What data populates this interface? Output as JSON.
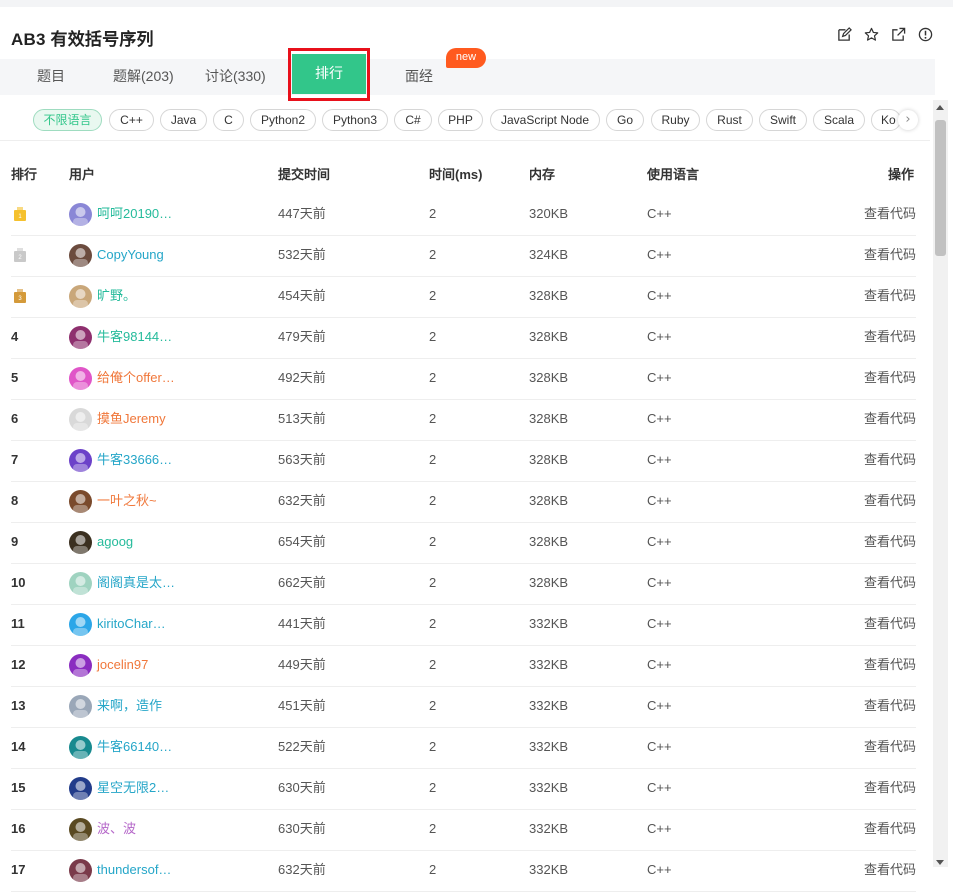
{
  "header": {
    "title": "AB3  有效括号序列"
  },
  "tabs": [
    {
      "label": "题目"
    },
    {
      "label": "题解(203)"
    },
    {
      "label": "讨论(330)"
    },
    {
      "label": "排行"
    },
    {
      "label": "面经"
    }
  ],
  "new_badge": "new",
  "languages": [
    "不限语言",
    "C++",
    "Java",
    "C",
    "Python2",
    "Python3",
    "C#",
    "PHP",
    "JavaScript Node",
    "Go",
    "Ruby",
    "Rust",
    "Swift",
    "Scala",
    "Ko"
  ],
  "columns": {
    "rank": "排行",
    "user": "用户",
    "time": "提交时间",
    "ms": "时间(ms)",
    "mem": "内存",
    "lang": "使用语言",
    "op": "操作"
  },
  "rows": [
    {
      "rank": "1",
      "user": "呵呵20190…",
      "time": "447天前",
      "ms": "2",
      "mem": "320KB",
      "lang": "C++",
      "op": "查看代码",
      "color": "#25bb9b"
    },
    {
      "rank": "2",
      "user": "CopyYoung",
      "time": "532天前",
      "ms": "2",
      "mem": "324KB",
      "lang": "C++",
      "op": "查看代码",
      "color": "#25a6c8"
    },
    {
      "rank": "3",
      "user": "旷野。",
      "time": "454天前",
      "ms": "2",
      "mem": "328KB",
      "lang": "C++",
      "op": "查看代码",
      "color": "#25bb9b"
    },
    {
      "rank": "4",
      "user": "牛客98144…",
      "time": "479天前",
      "ms": "2",
      "mem": "328KB",
      "lang": "C++",
      "op": "查看代码",
      "color": "#25bb9b"
    },
    {
      "rank": "5",
      "user": "给俺个offer…",
      "time": "492天前",
      "ms": "2",
      "mem": "328KB",
      "lang": "C++",
      "op": "查看代码",
      "color": "#f0773a"
    },
    {
      "rank": "6",
      "user": "摸鱼Jeremy",
      "time": "513天前",
      "ms": "2",
      "mem": "328KB",
      "lang": "C++",
      "op": "查看代码",
      "color": "#f0773a"
    },
    {
      "rank": "7",
      "user": "牛客33666…",
      "time": "563天前",
      "ms": "2",
      "mem": "328KB",
      "lang": "C++",
      "op": "查看代码",
      "color": "#25a6c8"
    },
    {
      "rank": "8",
      "user": "一叶之秋~",
      "time": "632天前",
      "ms": "2",
      "mem": "328KB",
      "lang": "C++",
      "op": "查看代码",
      "color": "#f0773a"
    },
    {
      "rank": "9",
      "user": "agoog",
      "time": "654天前",
      "ms": "2",
      "mem": "328KB",
      "lang": "C++",
      "op": "查看代码",
      "color": "#25bb9b"
    },
    {
      "rank": "10",
      "user": "阁阁真是太…",
      "time": "662天前",
      "ms": "2",
      "mem": "328KB",
      "lang": "C++",
      "op": "查看代码",
      "color": "#25a6c8"
    },
    {
      "rank": "11",
      "user": "kiritoChar…",
      "time": "441天前",
      "ms": "2",
      "mem": "332KB",
      "lang": "C++",
      "op": "查看代码",
      "color": "#25a6c8"
    },
    {
      "rank": "12",
      "user": "jocelin97",
      "time": "449天前",
      "ms": "2",
      "mem": "332KB",
      "lang": "C++",
      "op": "查看代码",
      "color": "#f0773a"
    },
    {
      "rank": "13",
      "user": "来啊，造作",
      "time": "451天前",
      "ms": "2",
      "mem": "332KB",
      "lang": "C++",
      "op": "查看代码",
      "color": "#25a6c8"
    },
    {
      "rank": "14",
      "user": "牛客66140…",
      "time": "522天前",
      "ms": "2",
      "mem": "332KB",
      "lang": "C++",
      "op": "查看代码",
      "color": "#25a6c8"
    },
    {
      "rank": "15",
      "user": "星空无限2…",
      "time": "630天前",
      "ms": "2",
      "mem": "332KB",
      "lang": "C++",
      "op": "查看代码",
      "color": "#25a6c8"
    },
    {
      "rank": "16",
      "user": "波、波",
      "time": "630天前",
      "ms": "2",
      "mem": "332KB",
      "lang": "C++",
      "op": "查看代码",
      "color": "#b567c9"
    },
    {
      "rank": "17",
      "user": "thundersof…",
      "time": "632天前",
      "ms": "2",
      "mem": "332KB",
      "lang": "C++",
      "op": "查看代码",
      "color": "#25a6c8"
    }
  ],
  "medal_colors": [
    "#f5c12e",
    "#c9c9c9",
    "#d49a3a"
  ],
  "avatar_colors": [
    "#8a87d6",
    "#6b4b3e",
    "#c9a77a",
    "#8e2f6e",
    "#e055c8",
    "#d9d9d9",
    "#6c42c9",
    "#7a4a2c",
    "#3b3020",
    "#9fd3c0",
    "#2ba6e8",
    "#8a2cc0",
    "#9aa7b8",
    "#188a8f",
    "#223c8a",
    "#5a4a22",
    "#7a3a4a"
  ],
  "accent": "#32c68a"
}
